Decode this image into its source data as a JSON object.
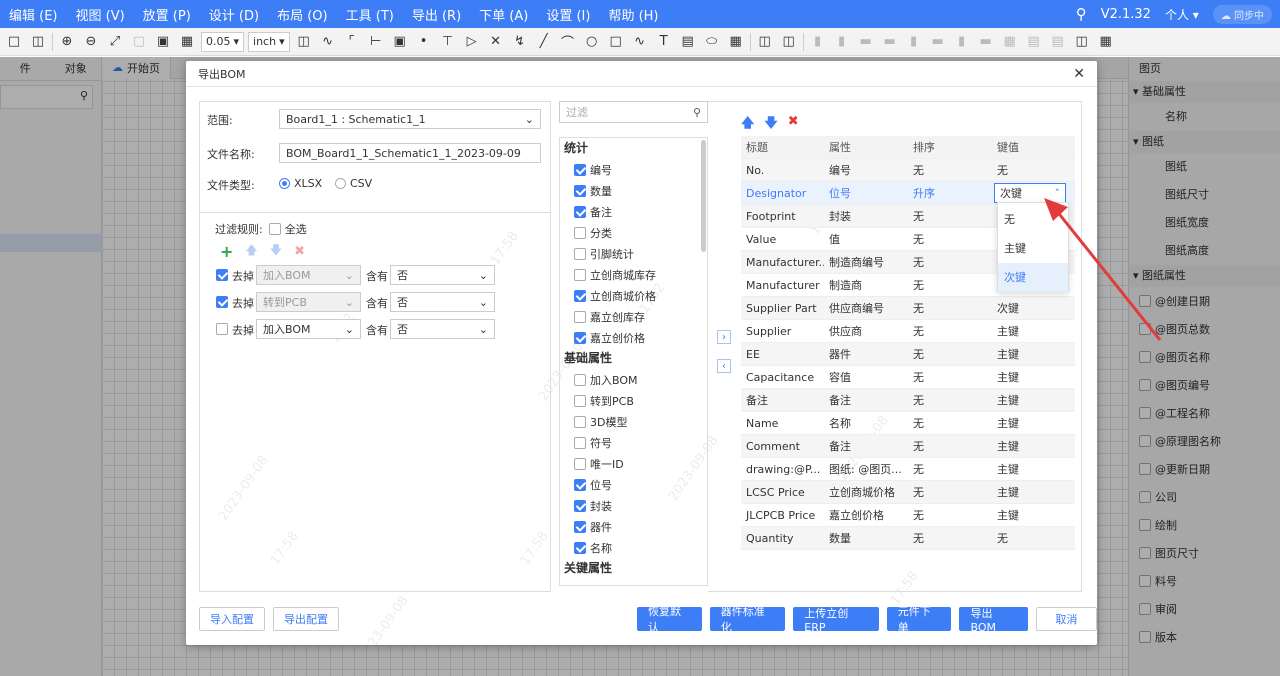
{
  "menu": [
    "编辑 (E)",
    "视图 (V)",
    "放置 (P)",
    "设计 (D)",
    "布局 (O)",
    "工具 (T)",
    "导出 (R)",
    "下单 (A)",
    "设置 (I)",
    "帮助 (H)"
  ],
  "header_right": {
    "version": "V2.1.32",
    "user": "个人",
    "sync": "同步中"
  },
  "toolbar": {
    "grid_value": "0.05",
    "unit_value": "inch"
  },
  "left_panel": {
    "tab_files": "件",
    "tab_objects": "对象"
  },
  "doc_tabs": {
    "start_page": "开始页"
  },
  "right_panel": {
    "title": "图页",
    "section_basic": "基础属性",
    "item_name": "名称",
    "section_paper": "图纸",
    "paper_items": [
      "图纸",
      "图纸尺寸",
      "图纸宽度",
      "图纸高度"
    ],
    "section_paper_attrs": "图纸属性",
    "attr_items": [
      "@创建日期",
      "@图页总数",
      "@图页名称",
      "@图页编号",
      "@工程名称",
      "@原理图名称",
      "@更新日期",
      "公司",
      "绘制",
      "图页尺寸",
      "料号",
      "审阅",
      "版本"
    ]
  },
  "dialog": {
    "title": "导出BOM",
    "scope_label": "范围:",
    "scope_value": "Board1_1 : Schematic1_1",
    "filename_label": "文件名称:",
    "filename_value": "BOM_Board1_1_Schematic1_1_2023-09-09",
    "filetype_label": "文件类型:",
    "filetype_xlsx": "XLSX",
    "filetype_csv": "CSV",
    "filter_rules_label": "过滤规则:",
    "select_all_label": "全选",
    "rules": [
      {
        "checked": true,
        "action": "去掉",
        "field": "加入BOM",
        "field_disabled": true,
        "op": "含有",
        "value": "否"
      },
      {
        "checked": true,
        "action": "去掉",
        "field": "转到PCB",
        "field_disabled": true,
        "op": "含有",
        "value": "否"
      },
      {
        "checked": false,
        "action": "去掉",
        "field": "加入BOM",
        "field_disabled": false,
        "op": "含有",
        "value": "否"
      }
    ],
    "filter_placeholder": "过滤",
    "field_groups": [
      {
        "title": "统计",
        "items": [
          {
            "label": "编号",
            "checked": true
          },
          {
            "label": "数量",
            "checked": true
          },
          {
            "label": "备注",
            "checked": true
          },
          {
            "label": "分类",
            "checked": false
          },
          {
            "label": "引脚统计",
            "checked": false
          },
          {
            "label": "立创商城库存",
            "checked": false
          },
          {
            "label": "立创商城价格",
            "checked": true
          },
          {
            "label": "嘉立创库存",
            "checked": false
          },
          {
            "label": "嘉立创价格",
            "checked": true
          }
        ]
      },
      {
        "title": "基础属性",
        "items": [
          {
            "label": "加入BOM",
            "checked": false
          },
          {
            "label": "转到PCB",
            "checked": false
          },
          {
            "label": "3D模型",
            "checked": false
          },
          {
            "label": "符号",
            "checked": false
          },
          {
            "label": "唯一ID",
            "checked": false
          },
          {
            "label": "位号",
            "checked": true
          },
          {
            "label": "封装",
            "checked": true
          },
          {
            "label": "器件",
            "checked": true
          },
          {
            "label": "名称",
            "checked": true
          }
        ]
      },
      {
        "title": "关键属性",
        "items": []
      }
    ],
    "table_headers": [
      "标题",
      "属性",
      "排序",
      "键值"
    ],
    "table_rows": [
      [
        "No.",
        "编号",
        "无",
        "无"
      ],
      [
        "Designator",
        "位号",
        "升序",
        "次键"
      ],
      [
        "Footprint",
        "封装",
        "无",
        ""
      ],
      [
        "Value",
        "值",
        "无",
        ""
      ],
      [
        "Manufacturer...",
        "制造商编号",
        "无",
        ""
      ],
      [
        "Manufacturer",
        "制造商",
        "无",
        ""
      ],
      [
        "Supplier Part",
        "供应商编号",
        "无",
        "次键"
      ],
      [
        "Supplier",
        "供应商",
        "无",
        "主键"
      ],
      [
        "EE",
        "器件",
        "无",
        "主键"
      ],
      [
        "Capacitance",
        "容值",
        "无",
        "主键"
      ],
      [
        "备注",
        "备注",
        "无",
        "主键"
      ],
      [
        "Name",
        "名称",
        "无",
        "主键"
      ],
      [
        "Comment",
        "备注",
        "无",
        "主键"
      ],
      [
        "drawing:@P...",
        "图纸: @图页...",
        "无",
        "主键"
      ],
      [
        "LCSC Price",
        "立创商城价格",
        "无",
        "主键"
      ],
      [
        "JLCPCB Price",
        "嘉立创价格",
        "无",
        "主键"
      ],
      [
        "Quantity",
        "数量",
        "无",
        "无"
      ]
    ],
    "key_dropdown": {
      "current": "次键",
      "options": [
        "无",
        "主键",
        "次键"
      ],
      "highlighted": "次键"
    },
    "buttons_left": [
      "导入配置",
      "导出配置"
    ],
    "buttons_right": [
      "恢复默认",
      "器件标准化",
      "上传立创ERP",
      "元件下单",
      "导出BOM"
    ],
    "cancel": "取消"
  },
  "watermarks": [
    "2023-09-08",
    "17:58",
    "1762",
    "2023-09-08",
    "17:58",
    "2023-09-08",
    "17:58",
    "1762",
    "2023-09-08",
    "17:58",
    "2023-09-08",
    "17:58"
  ],
  "colors": {
    "accent": "#3d7df6",
    "annotation_arrow": "#e23b3b",
    "delete": "#e53935",
    "add": "#2aa84a"
  }
}
